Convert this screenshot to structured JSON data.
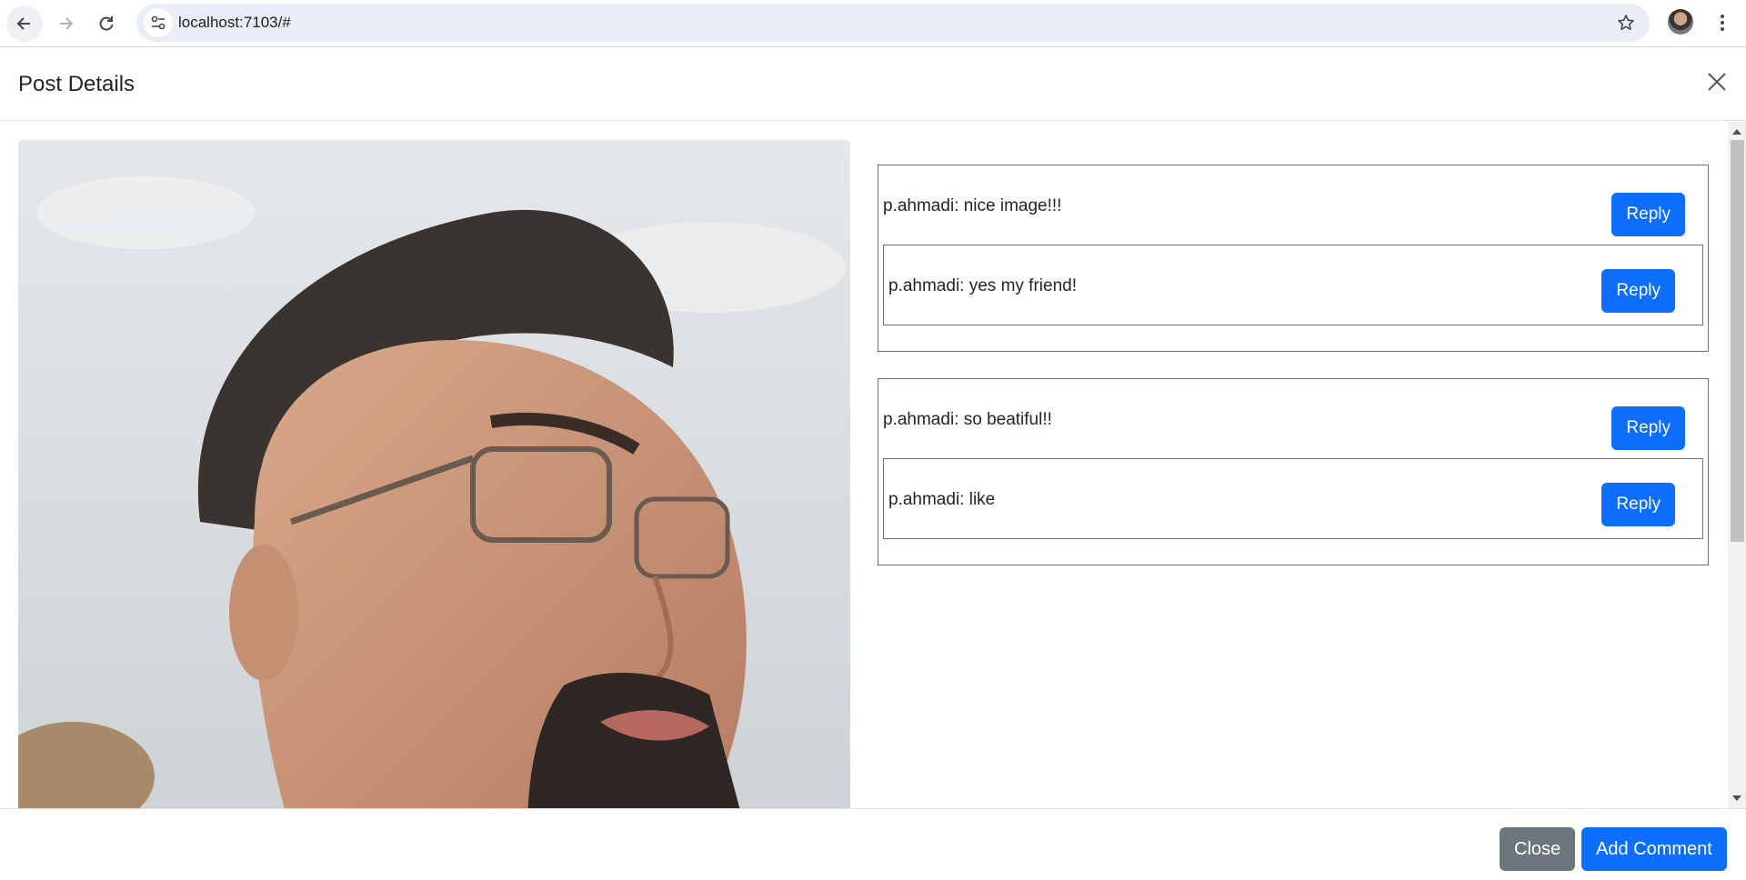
{
  "browser": {
    "url": "localhost:7103/#"
  },
  "modal": {
    "title": "Post Details",
    "comments": [
      {
        "text": "p.ahmadi: nice image!!!",
        "reply_label": "Reply",
        "replies": [
          {
            "text": "p.ahmadi: yes my friend!",
            "reply_label": "Reply"
          }
        ]
      },
      {
        "text": "p.ahmadi: so beatiful!!",
        "reply_label": "Reply",
        "replies": [
          {
            "text": "p.ahmadi: like",
            "reply_label": "Reply"
          }
        ]
      }
    ],
    "footer": {
      "close_label": "Close",
      "add_comment_label": "Add Comment"
    }
  },
  "colors": {
    "primary": "#0d6efd",
    "secondary": "#6c757d"
  }
}
